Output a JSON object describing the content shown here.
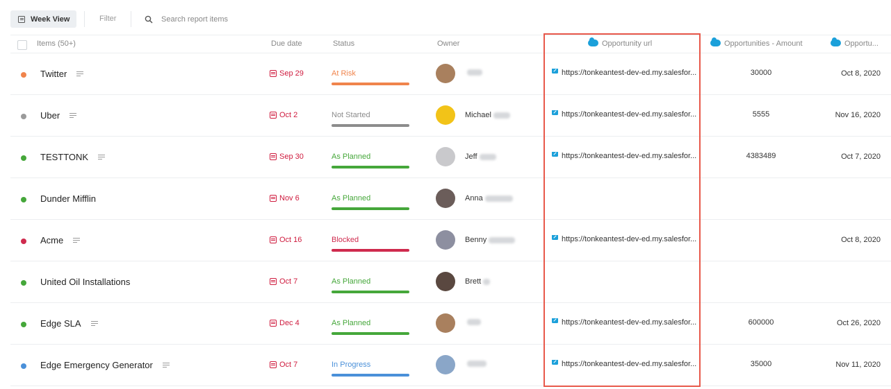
{
  "toolbar": {
    "week_view_label": "Week View",
    "filter_label": "Filter",
    "search_placeholder": "Search report items"
  },
  "columns": {
    "items": "Items (50+)",
    "due_date": "Due date",
    "status": "Status",
    "owner": "Owner",
    "opportunity_url": "Opportunity url",
    "opportunities_amount": "Opportunities - Amount",
    "opportu": "Opportu..."
  },
  "colors": {
    "at_risk": "#f0844c",
    "not_started": "#8c8c8c",
    "as_planned": "#45a73a",
    "blocked": "#cf2b4e",
    "in_progress": "#4a90d9",
    "salesforce": "#1ba0da",
    "highlight": "#e8584a"
  },
  "rows": [
    {
      "name": "Twitter",
      "dot_color": "#f0844c",
      "due": "Sep 29",
      "status": "At Risk",
      "status_color": "#f0844c",
      "owner": "",
      "avatar_color": "#a9805e",
      "url": "https://tonkeantest-dev-ed.my.salesfor...",
      "amount": "30000",
      "opp_date": "Oct 8, 2020",
      "has_notes": true
    },
    {
      "name": "Uber",
      "dot_color": "#9a9a9a",
      "due": "Oct 2",
      "status": "Not Started",
      "status_color": "#8c8c8c",
      "owner": "Michael",
      "avatar_color": "#f2c318",
      "url": "https://tonkeantest-dev-ed.my.salesfor...",
      "amount": "5555",
      "opp_date": "Nov 16, 2020",
      "has_notes": true
    },
    {
      "name": "TESTTONK",
      "dot_color": "#45a73a",
      "due": "Sep 30",
      "status": "As Planned",
      "status_color": "#45a73a",
      "owner": "Jeff",
      "avatar_color": "#c9c9cc",
      "url": "https://tonkeantest-dev-ed.my.salesfor...",
      "amount": "4383489",
      "opp_date": "Oct 7, 2020",
      "has_notes": true
    },
    {
      "name": "Dunder Mifflin",
      "dot_color": "#45a73a",
      "due": "Nov 6",
      "status": "As Planned",
      "status_color": "#45a73a",
      "owner": "Anna",
      "avatar_color": "#6b5d5a",
      "url": "",
      "amount": "",
      "opp_date": "",
      "has_notes": false
    },
    {
      "name": "Acme",
      "dot_color": "#cf2b4e",
      "due": "Oct 16",
      "status": "Blocked",
      "status_color": "#cf2b4e",
      "owner": "Benny",
      "avatar_color": "#8d8fa0",
      "url": "https://tonkeantest-dev-ed.my.salesfor...",
      "amount": "",
      "opp_date": "Oct 8, 2020",
      "has_notes": true
    },
    {
      "name": "United Oil Installations",
      "dot_color": "#45a73a",
      "due": "Oct 7",
      "status": "As Planned",
      "status_color": "#45a73a",
      "owner": "Brett",
      "avatar_color": "#5a4840",
      "url": "",
      "amount": "",
      "opp_date": "",
      "has_notes": false
    },
    {
      "name": "Edge SLA",
      "dot_color": "#45a73a",
      "due": "Dec 4",
      "status": "As Planned",
      "status_color": "#45a73a",
      "owner": "",
      "avatar_color": "#a9805e",
      "url": "https://tonkeantest-dev-ed.my.salesfor...",
      "amount": "600000",
      "opp_date": "Oct 26, 2020",
      "has_notes": true
    },
    {
      "name": "Edge Emergency Generator",
      "dot_color": "#4a90d9",
      "due": "Oct 7",
      "status": "In Progress",
      "status_color": "#4a90d9",
      "owner": "",
      "avatar_color": "#8aa6c8",
      "url": "https://tonkeantest-dev-ed.my.salesfor...",
      "amount": "35000",
      "opp_date": "Nov 11, 2020",
      "has_notes": true
    }
  ]
}
